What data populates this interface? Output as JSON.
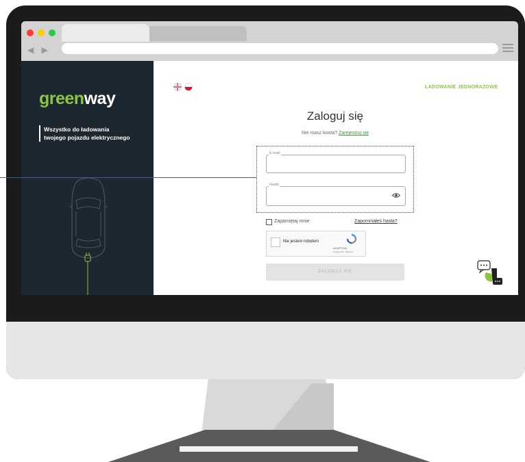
{
  "colors": {
    "brand_green": "#8cc63f",
    "sidebar_bg": "#1d2730",
    "link_green": "#3a9b3a",
    "button_disabled_bg": "#e3e3e3"
  },
  "browser": {
    "traffic_lights": [
      "#ff3b30",
      "#ffcc00",
      "#28c840"
    ],
    "nav_arrows": "◀ ▶"
  },
  "sidebar": {
    "logo_part1": "green",
    "logo_part2": "way",
    "tagline_line1": "Wszystko do ładowania",
    "tagline_line2": "twojego pojazdu elektrycznego",
    "illustration": "car-top-view-icon",
    "plug_icon": "charging-plug-icon"
  },
  "header": {
    "languages": [
      "english-flag-icon",
      "polish-flag-icon"
    ],
    "one_time_charging": "ŁADOWANIE JEDNORAZOWE"
  },
  "login": {
    "title": "Zaloguj się",
    "no_account_text": "Nie masz konta?",
    "register_link": "Zarejestruj się",
    "email_label": "E-mail",
    "password_label": "Hasło",
    "show_password_icon": "eye-icon",
    "remember_me": "Zapamiętaj mnie",
    "forgot_password": "Zapomniałeś hasła?",
    "submit": "ZALOGUJ SIĘ"
  },
  "recaptcha": {
    "label": "Nie jestem robotem",
    "brand": "reCAPTCHA",
    "terms": "Prywatność - Warunki"
  },
  "chat": {
    "icon": "chat-widget-icon"
  }
}
